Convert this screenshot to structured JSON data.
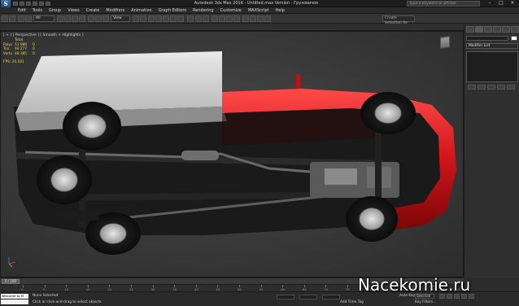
{
  "window": {
    "title": "Autodesk 3ds Max 2016 - Untitled.max Version - Грузовичок",
    "search_placeholder": "Type a keyword or phrase",
    "app_logo_letter": "S",
    "min_icon": "minimize-icon",
    "max_icon": "maximize-icon",
    "close_icon": "close-icon"
  },
  "menu": {
    "items": [
      "Edit",
      "Tools",
      "Group",
      "Views",
      "Create",
      "Modifiers",
      "Animation",
      "Graph Editors",
      "Rendering",
      "Customize",
      "MAXScript",
      "Help"
    ]
  },
  "toolbar": {
    "selection_filter": "All",
    "ref_coord": "View",
    "named_selection": "Create Selection Se"
  },
  "viewport": {
    "label": "[ + ] [ Perspective ] [ Smooth + Highlights ]",
    "stats_header": "Total",
    "stats": [
      {
        "key": "Polys",
        "value": "51 989",
        "extra": "0"
      },
      {
        "key": "Tris",
        "value": "94 277",
        "extra": "0"
      },
      {
        "key": "Verts",
        "value": "48 385",
        "extra": "0"
      }
    ],
    "fps_label": "FPS:",
    "fps_value": "20.181"
  },
  "command_panel": {
    "modifier_list": "Modifier List"
  },
  "timeline": {
    "slider_value": "0 / 100",
    "ticks": [
      "0",
      "5",
      "10",
      "15",
      "20",
      "25",
      "30",
      "35",
      "40",
      "45",
      "50",
      "55",
      "60",
      "65",
      "70",
      "75",
      "80",
      "85",
      "90",
      "95",
      "100"
    ]
  },
  "statusbar": {
    "script_text": "Welcome to M",
    "selection": "None Selected",
    "prompt": "Click or click-and-drag to select objects",
    "add_time_tag": "Add Time Tag",
    "autokey_label": "Auto Key",
    "autokey_value": "Selected",
    "key_filters": "Key Filters..."
  },
  "watermark": "Nacekomie.ru",
  "colors": {
    "truck_red": "#d01418",
    "stats_yellow": "#e7d35c",
    "viewport_bg": "#3c3c3c"
  }
}
